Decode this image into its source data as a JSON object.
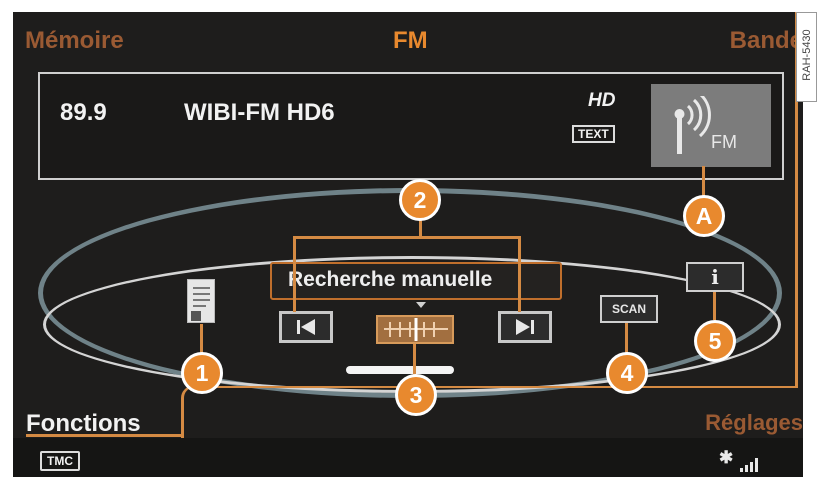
{
  "tabs": {
    "left": "Mémoire",
    "center": "FM",
    "right": "Bande"
  },
  "station": {
    "frequency": "89.9",
    "name": "WIBI-FM HD6",
    "hd_logo": "HD",
    "text_badge": "TEXT",
    "art_label": "FM"
  },
  "controls": {
    "search_label": "Recherche manuelle",
    "scan_label": "SCAN",
    "info_label": "i",
    "prev_icon": "skip-back-icon",
    "next_icon": "skip-forward-icon",
    "tune_icon": "manual-tune-icon",
    "memo_icon": "document-memo-icon"
  },
  "callouts": {
    "c1": "1",
    "c2": "2",
    "c3": "3",
    "c4": "4",
    "c5": "5",
    "cA": "A"
  },
  "bottom_tabs": {
    "left": "Fonctions",
    "right": "Réglages"
  },
  "status": {
    "tmc": "TMC",
    "bluetooth_icon": "bluetooth-icon",
    "signal_icon": "signal-strength-icon"
  },
  "side_code": "RAH-5430",
  "colors": {
    "accent_orange": "#e8892e",
    "dim_orange": "#9a5a33",
    "screen_bg": "#1e1d1c",
    "ring": "#6f8288",
    "art_bg": "#7c7c7c"
  }
}
